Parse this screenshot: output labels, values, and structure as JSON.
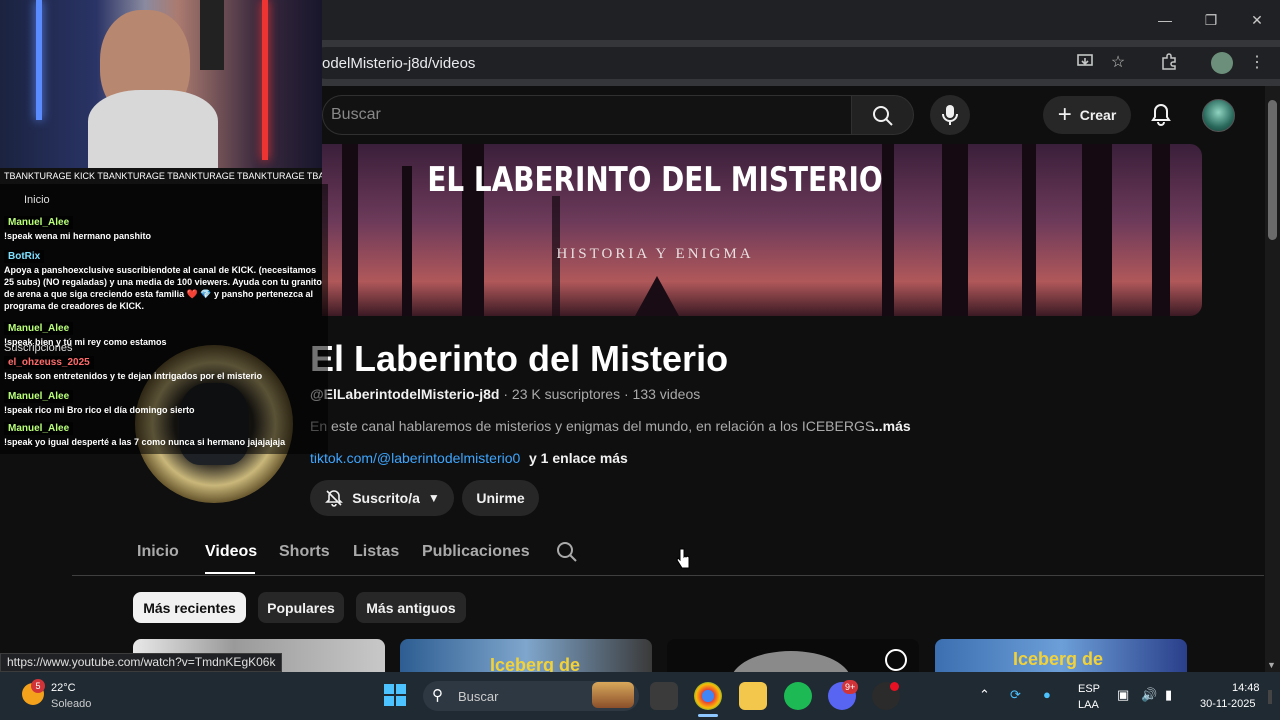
{
  "browser": {
    "url": "odelMisterio-j8d/videos",
    "status_url": "https://www.youtube.com/watch?v=TmdnKEgK06k"
  },
  "youtube": {
    "search_placeholder": "Buscar",
    "create_label": "Crear"
  },
  "banner": {
    "title": "EL LABERINTO DEL MISTERIO",
    "subtitle": "HISTORIA Y ENIGMA"
  },
  "channel": {
    "name": "El Laberinto del Misterio",
    "handle": "@ElLaberintodelMisterio-j8d",
    "subscribers": "23 K suscriptores",
    "videos": "133 videos",
    "separator": "·",
    "description": "En este canal hablaremos de misterios y enigmas del mundo, en relación a los ICEBERGS.",
    "description_more": "...más",
    "link": "tiktok.com/@laberintodelmisterio0",
    "link_more": "y 1 enlace más",
    "subscribed_label": "Suscrito/a",
    "join_label": "Unirme"
  },
  "tabs": [
    {
      "label": "Inicio",
      "active": false
    },
    {
      "label": "Videos",
      "active": true
    },
    {
      "label": "Shorts",
      "active": false
    },
    {
      "label": "Listas",
      "active": false
    },
    {
      "label": "Publicaciones",
      "active": false
    }
  ],
  "chips": [
    {
      "label": "Más recientes",
      "active": true
    },
    {
      "label": "Populares",
      "active": false
    },
    {
      "label": "Más antiguos",
      "active": false
    }
  ],
  "overlay": {
    "social_strip": "TBANKTURAGE   KICK TBANKTURAGE   TBANKTURAGE   TBANKTURAGE   TBANKTURAGE",
    "ghost_nav": "Inicio",
    "ghost_subs": "Suscripciones",
    "chat": [
      {
        "user": "Manuel_Alee",
        "msg": "!speak wena mi hermano panshito"
      },
      {
        "user": "BotRix",
        "msg": "Apoya a panshoexclusive suscribiendote al canal de KICK. (necesitamos 25 subs) (NO regaladas) y una media de 100 viewers. Ayuda con tu granito de arena a que siga creciendo esta familia ❤️ 💎 y pansho pertenezca al programa de creadores de KICK."
      },
      {
        "user": "Manuel_Alee",
        "msg": "!speak bien y tú mi rey como estamos"
      },
      {
        "user": "el_ohzeuss_2025",
        "msg": "!speak son entretenidos y te dejan intrigados por el misterio"
      },
      {
        "user": "Manuel_Alee",
        "msg": "!speak rico mi Bro rico el día domingo sierto"
      },
      {
        "user": "Manuel_Alee",
        "msg": "!speak yo igual desperté a las 7 como nunca si hermano jajajajaja"
      }
    ]
  },
  "thumbnails": [
    {
      "caption": ""
    },
    {
      "caption": "Iceberg de"
    },
    {
      "caption": ""
    },
    {
      "caption": "Iceberg de"
    }
  ],
  "taskbar": {
    "weather_temp": "22°C",
    "weather_desc": "Soleado",
    "weather_badge": "5",
    "search_placeholder": "Buscar",
    "lang_top": "ESP",
    "lang_bottom": "LAA",
    "time": "14:48",
    "date": "30-11-2025",
    "discord_badge": "9+"
  },
  "colors": {
    "link": "#3ea6ff",
    "chat_name": "#b9ff7a"
  }
}
